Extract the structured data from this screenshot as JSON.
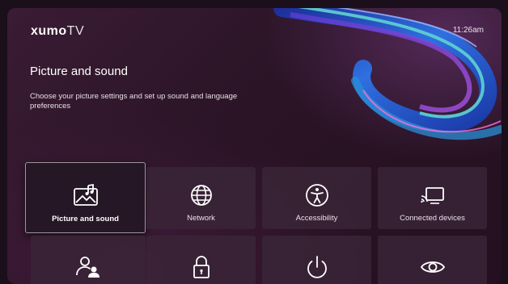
{
  "header": {
    "logo_bold": "xumo",
    "logo_light": "TV",
    "time": "11:26am"
  },
  "main": {
    "title": "Picture and sound",
    "subtitle": "Choose your picture settings and set up sound and language preferences"
  },
  "tiles": [
    {
      "label": "Picture and sound",
      "icon": "picture-sound-icon",
      "focused": true
    },
    {
      "label": "Network",
      "icon": "globe-icon"
    },
    {
      "label": "Accessibility",
      "icon": "accessibility-icon"
    },
    {
      "label": "Connected devices",
      "icon": "connected-devices-icon"
    },
    {
      "label": "",
      "icon": "users-icon"
    },
    {
      "label": "",
      "icon": "lock-icon"
    },
    {
      "label": "",
      "icon": "power-icon"
    },
    {
      "label": "",
      "icon": "eye-icon"
    }
  ],
  "colors": {
    "background": "#2a1426",
    "tile": "#3a2437",
    "focused_tile": "#251725",
    "text": "#ffffff"
  }
}
